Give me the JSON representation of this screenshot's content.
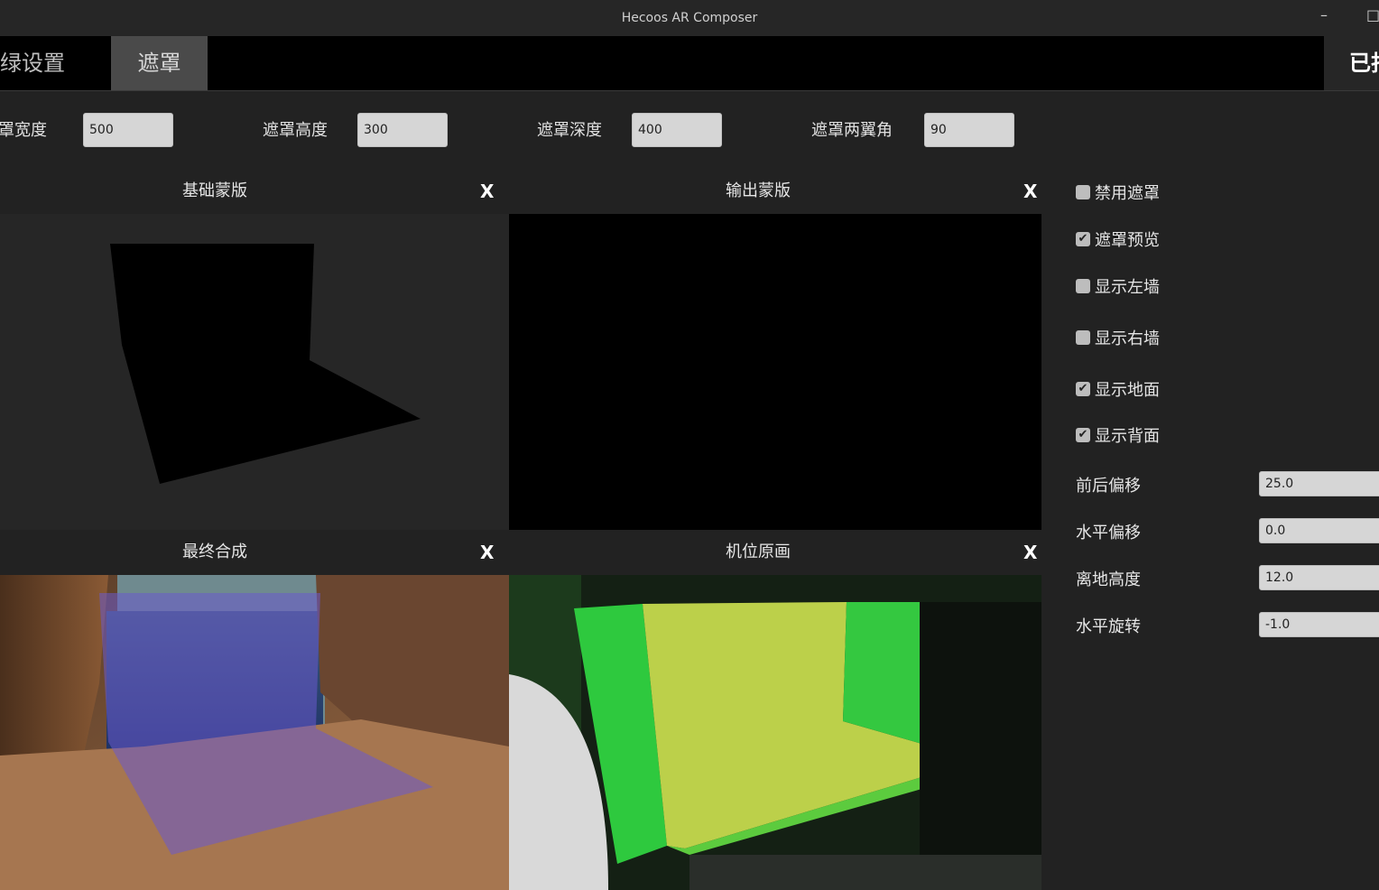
{
  "window": {
    "title": "Hecoos AR Composer",
    "minimize_glyph": "–",
    "maximize_glyph": "□"
  },
  "tabs": [
    {
      "label": "抠绿设置",
      "active": false
    },
    {
      "label": "遮罩",
      "active": true
    }
  ],
  "right_tab_label": "已扫",
  "mask_params": [
    {
      "label": "遮罩宽度",
      "value": "500"
    },
    {
      "label": "遮罩高度",
      "value": "300"
    },
    {
      "label": "遮罩深度",
      "value": "400"
    },
    {
      "label": "遮罩两翼角",
      "value": "90"
    }
  ],
  "panels": {
    "base_mask": {
      "title": "基础蒙版",
      "close": "X"
    },
    "output_mask": {
      "title": "输出蒙版",
      "close": "X"
    },
    "final_composite": {
      "title": "最终合成",
      "close": "X"
    },
    "camera_raw": {
      "title": "机位原画",
      "close": "X"
    }
  },
  "options": [
    {
      "label": "禁用遮罩",
      "checked": false
    },
    {
      "label": "遮罩预览",
      "checked": true
    },
    {
      "label": "显示左墙",
      "checked": false
    },
    {
      "label": "显示右墙",
      "checked": false
    },
    {
      "label": "显示地面",
      "checked": true
    },
    {
      "label": "显示背面",
      "checked": true
    }
  ],
  "transforms": [
    {
      "label": "前后偏移",
      "value": "25.0"
    },
    {
      "label": "水平偏移",
      "value": "0.0"
    },
    {
      "label": "离地高度",
      "value": "12.0"
    },
    {
      "label": "水平旋转",
      "value": "-1.0"
    }
  ],
  "colors": {
    "accent_green": "#2ec93e",
    "mask_overlay": "#6a5acd"
  }
}
